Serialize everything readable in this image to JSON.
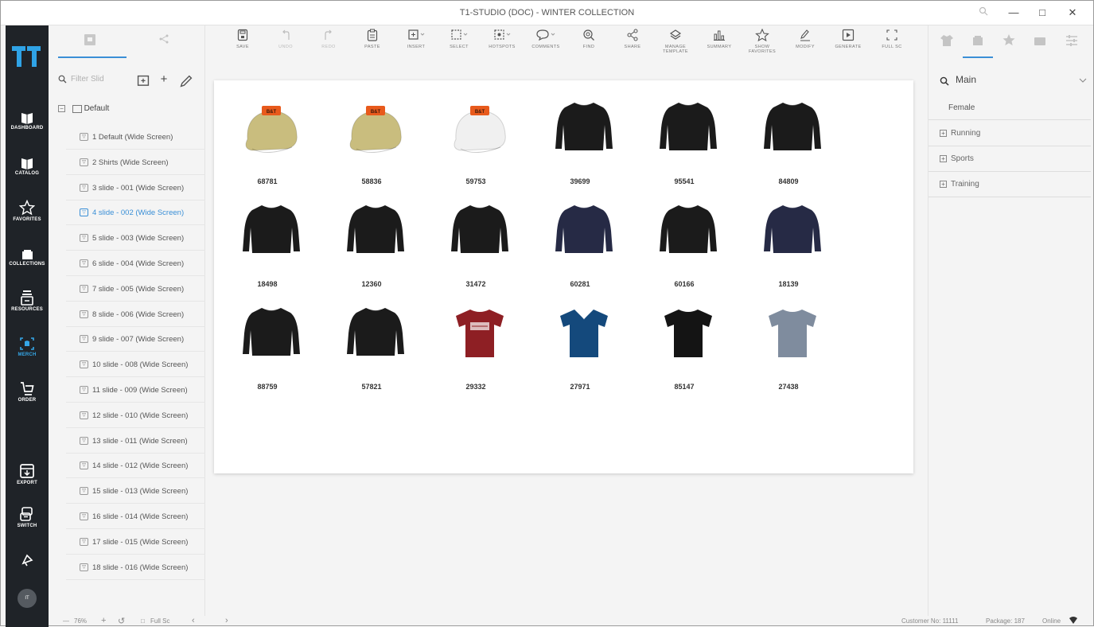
{
  "window": {
    "title": "T1-STUDIO (DOC) - WINTER COLLECTION"
  },
  "sidebar": {
    "items": [
      {
        "label": "DASHBOARD",
        "icon": "dashboard-icon"
      },
      {
        "label": "CATALOG",
        "icon": "catalog-icon"
      },
      {
        "label": "FAVORITES",
        "icon": "star-icon"
      },
      {
        "label": "COLLECTIONS",
        "icon": "collections-icon"
      },
      {
        "label": "RESOURCES",
        "icon": "resources-icon"
      },
      {
        "label": "MERCH",
        "icon": "merch-icon",
        "active": true
      },
      {
        "label": "ORDER",
        "icon": "cart-icon"
      },
      {
        "label": "EXPORT",
        "icon": "export-icon"
      },
      {
        "label": "SWITCH",
        "icon": "switch-icon"
      }
    ],
    "avatar": "IT"
  },
  "slides": {
    "filter_placeholder": "Filter Slid",
    "group": "Default",
    "items": [
      {
        "label": "1  Default (Wide Screen)"
      },
      {
        "label": "2  Shirts (Wide Screen)"
      },
      {
        "label": "3  slide - 001 (Wide Screen)"
      },
      {
        "label": "4  slide - 002 (Wide Screen)",
        "selected": true
      },
      {
        "label": "5  slide - 003 (Wide Screen)"
      },
      {
        "label": "6  slide - 004 (Wide Screen)"
      },
      {
        "label": "7  slide - 005 (Wide Screen)"
      },
      {
        "label": "8  slide - 006 (Wide Screen)"
      },
      {
        "label": "9  slide - 007 (Wide Screen)"
      },
      {
        "label": "10  slide - 008 (Wide Screen)"
      },
      {
        "label": "11  slide - 009 (Wide Screen)"
      },
      {
        "label": "12  slide - 010 (Wide Screen)"
      },
      {
        "label": "13  slide - 011 (Wide Screen)"
      },
      {
        "label": "14  slide - 012 (Wide Screen)"
      },
      {
        "label": "15  slide - 013 (Wide Screen)"
      },
      {
        "label": "16  slide - 014 (Wide Screen)"
      },
      {
        "label": "17  slide - 015 (Wide Screen)"
      },
      {
        "label": "18  slide - 016 (Wide Screen)"
      }
    ]
  },
  "toolbar": {
    "items": [
      {
        "label": "SAVE"
      },
      {
        "label": "UNDO",
        "disabled": true
      },
      {
        "label": "REDO",
        "disabled": true
      },
      {
        "label": "PASTE"
      },
      {
        "label": "INSERT"
      },
      {
        "label": "SELECT"
      },
      {
        "label": "HOTSPOTS"
      },
      {
        "label": "COMMENTS"
      },
      {
        "label": "FIND"
      },
      {
        "label": "SHARE"
      },
      {
        "label": "MANAGE TEMPLATE"
      },
      {
        "label": "SUMMARY"
      },
      {
        "label": "SHOW FAVORITES"
      },
      {
        "label": "MODIFY"
      },
      {
        "label": "GENERATE"
      },
      {
        "label": "FULL SC"
      }
    ]
  },
  "canvas": {
    "products": [
      {
        "code": "68781",
        "type": "cap",
        "color": "#c9bd7e",
        "badge": "B&T"
      },
      {
        "code": "58836",
        "type": "cap",
        "color": "#c9bd7e",
        "badge": "B&T"
      },
      {
        "code": "59753",
        "type": "cap",
        "color": "#f0f0f0",
        "badge": "B&T"
      },
      {
        "code": "39699",
        "type": "sweater",
        "color": "#1b1b1b"
      },
      {
        "code": "95541",
        "type": "sweater",
        "color": "#1b1b1b"
      },
      {
        "code": "84809",
        "type": "sweater",
        "color": "#1b1b1b"
      },
      {
        "code": "18498",
        "type": "sweater",
        "color": "#1b1b1b"
      },
      {
        "code": "12360",
        "type": "sweater",
        "color": "#1b1b1b"
      },
      {
        "code": "31472",
        "type": "sweater",
        "color": "#1b1b1b"
      },
      {
        "code": "60281",
        "type": "sweater",
        "color": "#262a45"
      },
      {
        "code": "60166",
        "type": "sweater",
        "color": "#1b1b1b"
      },
      {
        "code": "18139",
        "type": "sweater",
        "color": "#262a45"
      },
      {
        "code": "88759",
        "type": "sweater",
        "color": "#1b1b1b"
      },
      {
        "code": "57821",
        "type": "sweater",
        "color": "#1b1b1b"
      },
      {
        "code": "29332",
        "type": "tshirt",
        "color": "#8e1f24"
      },
      {
        "code": "27971",
        "type": "polo",
        "color": "#14497c"
      },
      {
        "code": "85147",
        "type": "tshirt",
        "color": "#141414"
      },
      {
        "code": "27438",
        "type": "tshirt",
        "color": "#7f8c9e"
      }
    ]
  },
  "filters": {
    "search_label": "Main",
    "selected": "Female",
    "categories": [
      "Running",
      "Sports",
      "Training"
    ]
  },
  "status": {
    "zoom": "76%",
    "fullscreen": "Full Sc",
    "customer": "Customer No: 11111",
    "package": "Package: 187",
    "online": "Online"
  },
  "colors": {
    "accent": "#3a8fd6",
    "nav_bg": "#1f2328",
    "merch_active": "#35a7e8",
    "logo": "#2fa3e6"
  }
}
